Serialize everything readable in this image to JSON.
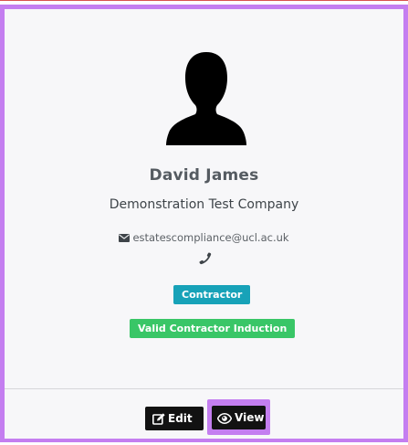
{
  "profile": {
    "name": "David James",
    "company": "Demonstration Test Company",
    "email": "estatescompliance@ucl.ac.uk",
    "avatar_icon": "person-silhouette-icon",
    "phone_icon": "phone-icon",
    "email_icon": "envelope-icon"
  },
  "badges": {
    "role": "Contractor",
    "induction": "Valid Contractor Induction"
  },
  "actions": {
    "edit_label": "Edit",
    "view_label": "View",
    "edit_icon": "edit-icon",
    "view_icon": "eye-icon"
  },
  "colors": {
    "highlight": "#c47ef0",
    "badge_contractor": "#17a2b8",
    "badge_induction": "#39c667",
    "button": "#121212"
  }
}
